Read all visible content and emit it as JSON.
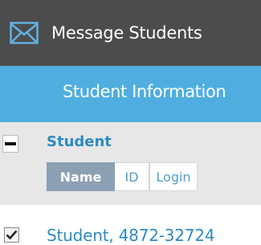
{
  "header": {
    "title": "Message Students",
    "icon": "envelope-icon",
    "background": "#4c4c4c"
  },
  "info_bar": {
    "label": "Student Information",
    "background": "#4faedf"
  },
  "table": {
    "column_header": "Student",
    "sort_options": [
      {
        "label": "Name",
        "selected": true
      },
      {
        "label": "ID",
        "selected": false
      },
      {
        "label": "Login",
        "selected": false
      }
    ],
    "rows": [
      {
        "name": "Student, 4872-32724",
        "checked": true
      }
    ]
  },
  "colors": {
    "link": "#2d8bc2",
    "selected_sort": "#8ca0b4"
  }
}
